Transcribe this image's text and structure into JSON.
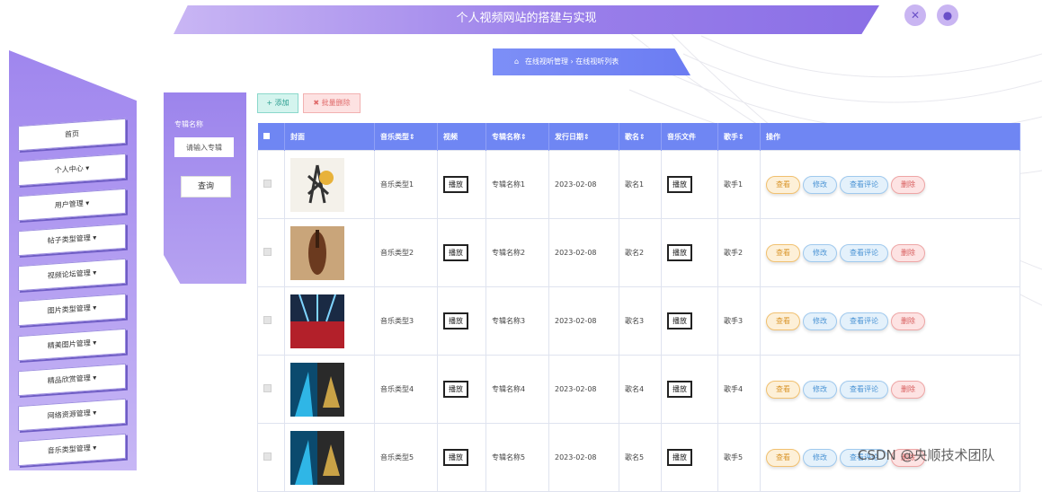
{
  "header": {
    "title": "个人视频网站的搭建与实现"
  },
  "breadcrumb": {
    "text": "在线视听管理 › 在线视听列表"
  },
  "sidebar": {
    "items": [
      {
        "label": "首页"
      },
      {
        "label": "个人中心 ▾"
      },
      {
        "label": "用户管理 ▾"
      },
      {
        "label": "帖子类型管理 ▾"
      },
      {
        "label": "视频论坛管理 ▾"
      },
      {
        "label": "图片类型管理 ▾"
      },
      {
        "label": "精美图片管理 ▾"
      },
      {
        "label": "精品欣赏管理 ▾"
      },
      {
        "label": "网络资源管理 ▾"
      },
      {
        "label": "音乐类型管理 ▾"
      }
    ]
  },
  "search": {
    "label": "专辑名称",
    "placeholder": "请输入专辑",
    "button": "查询"
  },
  "toolbar": {
    "add": "+ 添加",
    "batch_delete": "✖ 批量删除"
  },
  "table": {
    "headers": [
      "",
      "封面",
      "音乐类型⇕",
      "视频",
      "专辑名称⇕",
      "发行日期⇕",
      "歌名⇕",
      "音乐文件",
      "歌手⇕",
      "操作"
    ],
    "play_label": "播放",
    "actions": {
      "view": "查看",
      "edit": "修改",
      "comment": "查看评论",
      "delete": "删除"
    },
    "rows": [
      {
        "type": "音乐类型1",
        "album": "专辑名称1",
        "date": "2023-02-08",
        "song": "歌名1",
        "singer": "歌手1"
      },
      {
        "type": "音乐类型2",
        "album": "专辑名称2",
        "date": "2023-02-08",
        "song": "歌名2",
        "singer": "歌手2"
      },
      {
        "type": "音乐类型3",
        "album": "专辑名称3",
        "date": "2023-02-08",
        "song": "歌名3",
        "singer": "歌手3"
      },
      {
        "type": "音乐类型4",
        "album": "专辑名称4",
        "date": "2023-02-08",
        "song": "歌名4",
        "singer": "歌手4"
      },
      {
        "type": "音乐类型5",
        "album": "专辑名称5",
        "date": "2023-02-08",
        "song": "歌名5",
        "singer": "歌手5"
      }
    ]
  },
  "watermark": "CSDN @央顺技术团队",
  "colors": {
    "accent": "#6f86f3",
    "sidebar": "#9f86ee"
  }
}
